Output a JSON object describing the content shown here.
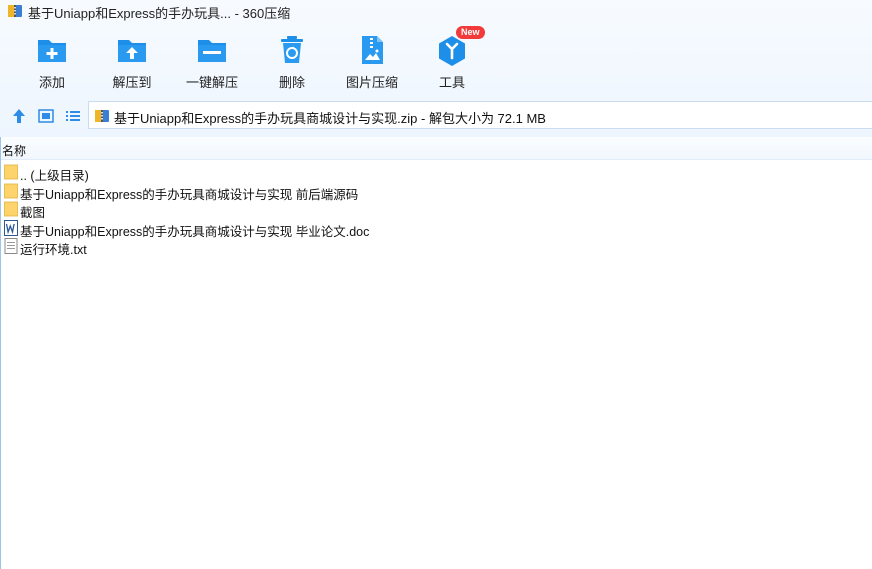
{
  "window": {
    "title": "基于Uniapp和Express的手办玩具... - 360压缩"
  },
  "toolbar": {
    "items": [
      {
        "label": "添加",
        "icon": "add-icon"
      },
      {
        "label": "解压到",
        "icon": "extract-to-icon"
      },
      {
        "label": "一键解压",
        "icon": "one-click-extract-icon"
      },
      {
        "label": "删除",
        "icon": "delete-icon"
      },
      {
        "label": "图片压缩",
        "icon": "image-compress-icon"
      },
      {
        "label": "工具",
        "icon": "tools-icon",
        "badge": "New"
      }
    ]
  },
  "address": {
    "text": "基于Uniapp和Express的手办玩具商城设计与实现.zip - 解包大小为 72.1 MB"
  },
  "list": {
    "column_header": "名称",
    "rows": [
      {
        "name": ".. (上级目录)",
        "icon": "folder-icon"
      },
      {
        "name": "基于Uniapp和Express的手办玩具商城设计与实现 前后端源码",
        "icon": "folder-icon"
      },
      {
        "name": "截图",
        "icon": "folder-icon"
      },
      {
        "name": "基于Uniapp和Express的手办玩具商城设计与实现 毕业论文.doc",
        "icon": "word-doc-icon"
      },
      {
        "name": "运行环境.txt",
        "icon": "text-file-icon"
      }
    ]
  },
  "colors": {
    "accent": "#1e8fe8",
    "badge": "#f23a3a",
    "folder": "#fcd46b"
  }
}
